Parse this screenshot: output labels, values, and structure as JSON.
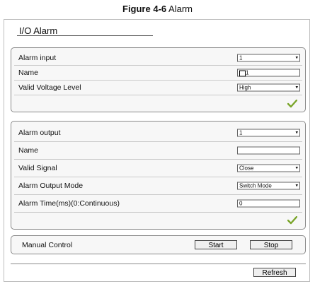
{
  "caption": {
    "figure": "Figure 4-6",
    "title": "Alarm"
  },
  "panel": {
    "title": "I/O Alarm"
  },
  "alarm_input_group": {
    "alarm_input": {
      "label": "Alarm input",
      "value": "1"
    },
    "name": {
      "label": "Name",
      "value": "1"
    },
    "voltage": {
      "label": "Valid Voltage Level",
      "value": "High"
    },
    "confirm_icon": "checkmark-icon"
  },
  "alarm_output_group": {
    "alarm_output": {
      "label": "Alarm output",
      "value": "1"
    },
    "name": {
      "label": "Name",
      "value": ""
    },
    "valid_signal": {
      "label": "Valid Signal",
      "value": "Close"
    },
    "output_mode": {
      "label": "Alarm Output Mode",
      "value": "Switch Mode"
    },
    "alarm_time": {
      "label": "Alarm Time(ms)(0:Continuous)",
      "value": "0"
    },
    "confirm_icon": "checkmark-icon"
  },
  "manual_control": {
    "label": "Manual Control",
    "start": "Start",
    "stop": "Stop"
  },
  "refresh": "Refresh",
  "colors": {
    "check_green": "#7aa52a"
  }
}
